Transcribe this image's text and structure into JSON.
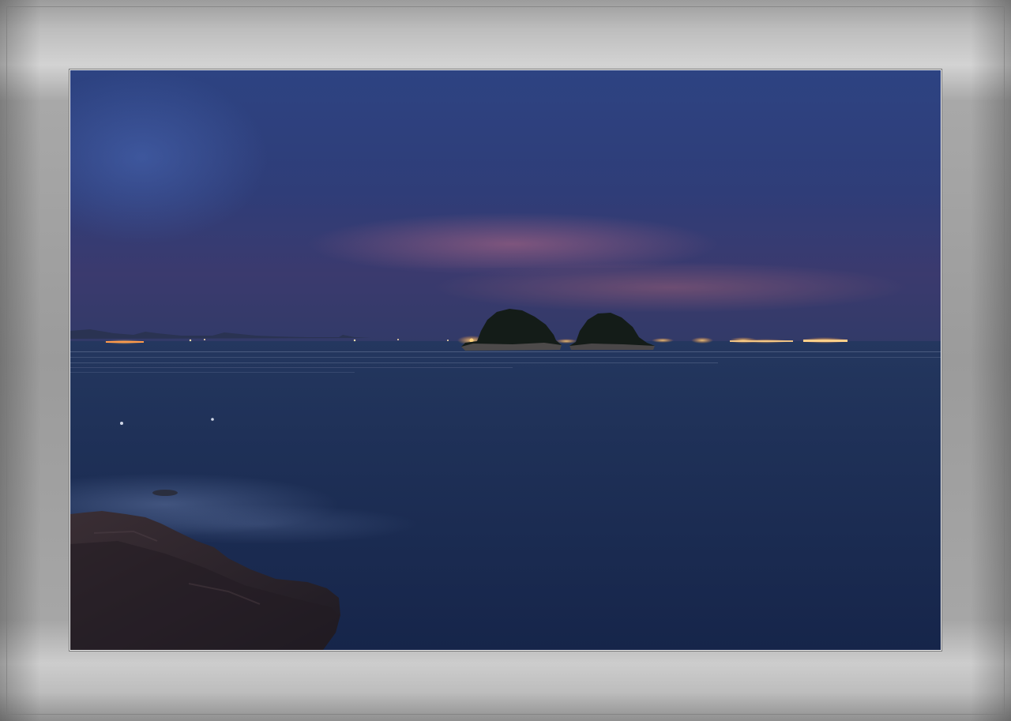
{
  "image": {
    "subject": "night-sea-twin-islets",
    "colors": {
      "frame": "#a3a3a3",
      "sky_top": "#2c3f80",
      "sky_band": "#6a4a78",
      "sea": "#1b2b52",
      "island": "#121a16",
      "lights": "#ffb347"
    }
  }
}
